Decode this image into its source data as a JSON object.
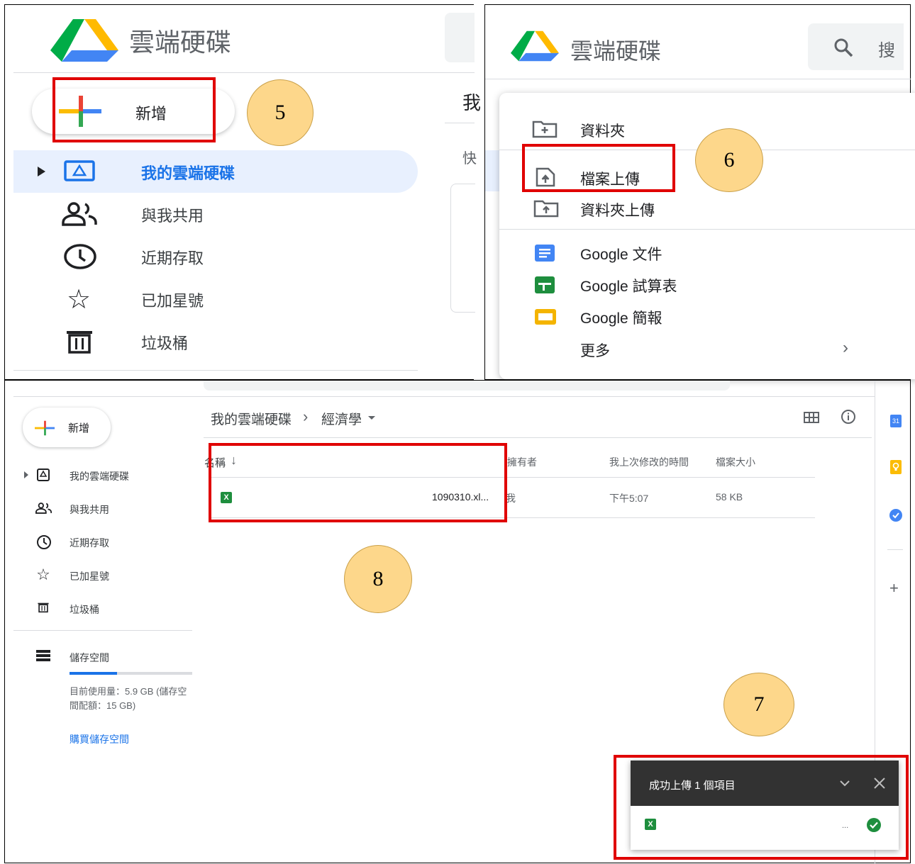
{
  "panel_a": {
    "brand": "雲端硬碟",
    "new_label": "新增",
    "cut_letter_1": "我",
    "cut_letter_2": "快",
    "nav": [
      {
        "label": "我的雲端硬碟",
        "icon": "drive-icon"
      },
      {
        "label": "與我共用",
        "icon": "shared-people-icon"
      },
      {
        "label": "近期存取",
        "icon": "clock-icon"
      },
      {
        "label": "已加星號",
        "icon": "star-icon"
      },
      {
        "label": "垃圾桶",
        "icon": "trash-icon"
      }
    ],
    "step": "5"
  },
  "panel_b": {
    "brand": "雲端硬碟",
    "search_placeholder": "搜",
    "menu": {
      "folder": "資料夾",
      "file_upload": "檔案上傳",
      "folder_upload": "資料夾上傳",
      "docs": "Google 文件",
      "sheets": "Google 試算表",
      "slides": "Google 簡報",
      "more": "更多"
    },
    "step": "6"
  },
  "panel_c": {
    "new_label": "新增",
    "nav": [
      {
        "label": "我的雲端硬碟",
        "icon": "drive-icon"
      },
      {
        "label": "與我共用",
        "icon": "shared-people-icon"
      },
      {
        "label": "近期存取",
        "icon": "clock-icon"
      },
      {
        "label": "已加星號",
        "icon": "star-icon"
      },
      {
        "label": "垃圾桶",
        "icon": "trash-icon"
      }
    ],
    "storage": {
      "label": "儲存空間",
      "usage_line1": "目前使用量：5.9 GB (儲存空",
      "usage_line2": "間配額：15 GB)",
      "buy": "購買儲存空間",
      "used_fraction": 0.39
    },
    "breadcrumb": {
      "root": "我的雲端硬碟",
      "separator": "›",
      "current": "經濟學"
    },
    "columns": {
      "name": "名稱",
      "owner": "擁有者",
      "modified": "我上次修改的時間",
      "size": "檔案大小"
    },
    "file": {
      "name": "1090310.xl...",
      "owner": "我",
      "modified": "下午5:07",
      "size": "58 KB",
      "icon_letter": "X"
    },
    "upload_toast": {
      "title": "成功上傳 1 個項目",
      "ellipsis": "...",
      "icon_letter": "X"
    },
    "right_rail": {
      "calendar_day": "31"
    },
    "steps": {
      "eight": "8",
      "seven": "7"
    }
  },
  "colors": {
    "drive_blue": "#1a73e8",
    "red": "#e00000",
    "circle": "#fdd78b",
    "sheets_green": "#1e8e3e",
    "docs_blue": "#4285f4",
    "slides_yellow": "#f4b400"
  }
}
